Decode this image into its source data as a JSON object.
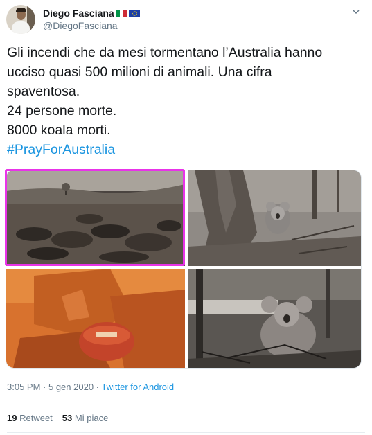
{
  "author": {
    "display_name": "Diego Fasciana",
    "handle": "@DiegoFasciana",
    "flag_it_colors": [
      "#009246",
      "#ffffff",
      "#ce2b37"
    ],
    "flag_eu_color": "#1d3fa6",
    "avatar_icon": "user-avatar",
    "menu_icon": "chevron-down-icon"
  },
  "tweet": {
    "lines": [
      "Gli incendi che da mesi tormentano l’Australia hanno",
      "ucciso quasi 500 milioni di animali. Una cifra",
      "spaventosa.",
      "24 persone morte.",
      "8000 koala morti."
    ],
    "hashtag": "#PrayForAustralia",
    "hashtag_color": "#1b95e0"
  },
  "media": {
    "photos": [
      "burned-field-dead-animals",
      "koala-at-burnt-tree",
      "firefighter-holding-koala",
      "koala-in-ashes"
    ],
    "highlight_color": "#e834e8"
  },
  "meta": {
    "time": "3:05 PM",
    "separator": " · ",
    "date": "5 gen 2020",
    "source": "Twitter for Android"
  },
  "stats": {
    "retweets_count": "19",
    "retweets_label": "Retweet",
    "likes_count": "53",
    "likes_label": "Mi piace"
  }
}
